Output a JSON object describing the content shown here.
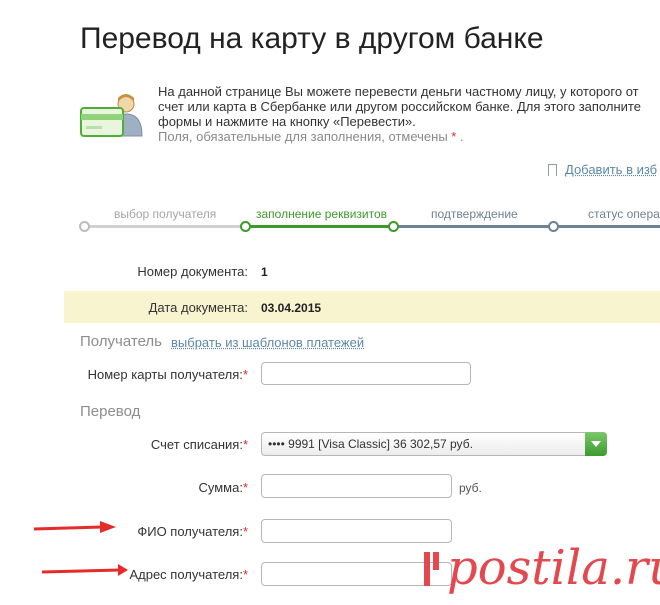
{
  "page": {
    "title": "Перевод на карту в другом банке",
    "intro_line1": "На данной странице Вы можете перевести деньги частному лицу, у которого от",
    "intro_line2": "счет или карта в Сбербанке или другом российском банке. Для этого заполните",
    "intro_line3": "формы и нажмите на кнопку «Перевести».",
    "required_hint": "Поля, обязательные для заполнения, отмечены ",
    "required_star": "*",
    "required_hint_end": " .",
    "bookmark_label": "Добавить в изб"
  },
  "steps": [
    {
      "label": "выбор получателя",
      "state": "done"
    },
    {
      "label": "заполнение реквизитов",
      "state": "active"
    },
    {
      "label": "подтверждение",
      "state": "pending"
    },
    {
      "label": "статус опера",
      "state": "pending"
    }
  ],
  "document": {
    "number_label": "Номер документа:",
    "number_value": "1",
    "date_label": "Дата документа:",
    "date_value": "03.04.2015"
  },
  "recipient": {
    "section_title": "Получатель",
    "templates_link": "выбрать из шаблонов платежей",
    "card_label": "Номер карты получателя:",
    "card_value": ""
  },
  "transfer": {
    "section_title": "Перевод",
    "account_label": "Счет списания:",
    "account_value": "•••• 9991 [Visa Classic] 36 302,57 руб.",
    "amount_label": "Сумма:",
    "amount_value": "",
    "amount_unit": "руб.",
    "fio_label": "ФИО получателя:",
    "fio_value": "",
    "address_label": "Адрес получателя:",
    "address_value": "",
    "required_star": "*"
  },
  "watermark": {
    "text": "postila.ru"
  },
  "colors": {
    "active_green": "#3c9a2a",
    "pending_slate": "#6d8294",
    "required_red": "#d62b2b",
    "annotation_red": "#e52b2b"
  }
}
